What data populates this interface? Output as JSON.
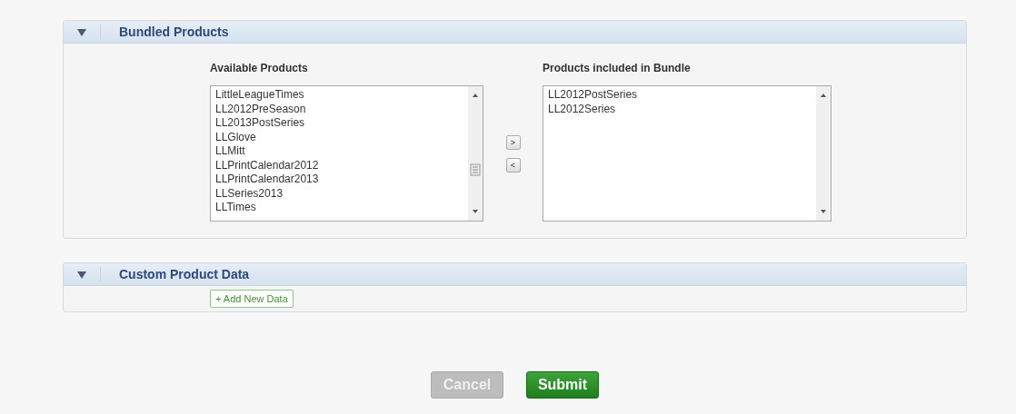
{
  "sections": [
    {
      "title": "Bundled Products",
      "expanded": true,
      "kind": "bundle",
      "available": {
        "label": "Available Products",
        "items": [
          "LittleLeagueTimes",
          "LL2012PreSeason",
          "LL2013PostSeries",
          "LLGlove",
          "LLMitt",
          "LLPrintCalendar2012",
          "LLPrintCalendar2013",
          "LLSeries2013",
          "LLTimes"
        ]
      },
      "move_buttons": [
        ">",
        "<"
      ],
      "included": {
        "label": "Products included in Bundle",
        "items": [
          "LL2012PostSeries",
          "LL2012Series"
        ]
      }
    },
    {
      "title": "Custom Product Data",
      "expanded": true,
      "kind": "custom",
      "add_button": "+ Add New Data"
    }
  ],
  "buttons": [
    {
      "label": "Cancel",
      "disabled": true,
      "kind": "cancel"
    },
    {
      "label": "Submit",
      "disabled": false,
      "kind": "submit"
    }
  ]
}
